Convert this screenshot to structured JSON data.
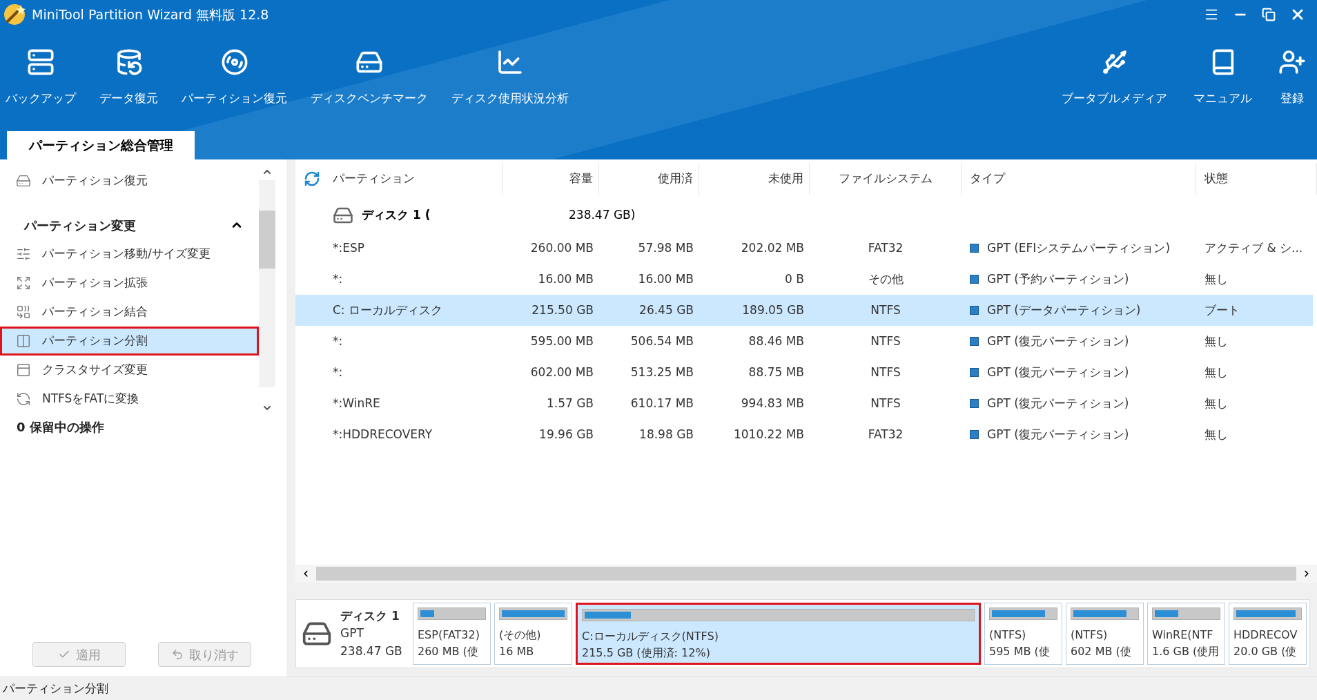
{
  "window": {
    "title": "MiniTool Partition Wizard 無料版 12.8"
  },
  "toolbar": {
    "left": [
      {
        "kind": "backup",
        "label": "バックアップ"
      },
      {
        "kind": "data",
        "label": "データ復元"
      },
      {
        "kind": "partition",
        "label": "パーティション復元"
      },
      {
        "kind": "bench",
        "label": "ディスクベンチマーク"
      },
      {
        "kind": "usage",
        "label": "ディスク使用状況分析"
      }
    ],
    "right": [
      {
        "kind": "media",
        "label": "ブータブルメディア"
      },
      {
        "kind": "manual",
        "label": "マニュアル"
      },
      {
        "kind": "register",
        "label": "登録"
      }
    ]
  },
  "tabs": [
    {
      "label": "パーティション総合管理",
      "selected": true
    }
  ],
  "sidebar": {
    "top_item": {
      "kind": "recover",
      "label": "パーティション復元"
    },
    "section": {
      "label": "パーティション変更",
      "expanded": true,
      "items": [
        {
          "kind": "move",
          "label": "パーティション移動/サイズ変更",
          "selected": false
        },
        {
          "kind": "extend",
          "label": "パーティション拡張",
          "selected": false
        },
        {
          "kind": "merge",
          "label": "パーティション結合",
          "selected": false
        },
        {
          "kind": "split",
          "label": "パーティション分割",
          "selected": true
        },
        {
          "kind": "cluster",
          "label": "クラスタサイズ変更",
          "selected": false
        },
        {
          "kind": "convert",
          "label": "NTFSをFATに変換",
          "selected": false
        }
      ]
    },
    "pending": "0 保留中の操作",
    "buttons": [
      {
        "kind": "apply",
        "label": "適用",
        "disabled": true
      },
      {
        "kind": "undo",
        "label": "取り消す",
        "disabled": true
      }
    ]
  },
  "table": {
    "columns": [
      "パーティション",
      "容量",
      "使用済",
      "未使用",
      "ファイルシステム",
      "タイプ",
      "状態"
    ],
    "disk_row": {
      "name": "ディスク 1 (",
      "size": "238.47 GB)"
    },
    "rows": [
      {
        "partition": "*:ESP",
        "capacity": "260.00 MB",
        "used": "57.98 MB",
        "unused": "202.02 MB",
        "fs": "FAT32",
        "type": "GPT (EFIシステムパーティション)",
        "status": "アクティブ & シ...",
        "selected": false
      },
      {
        "partition": "*:",
        "capacity": "16.00 MB",
        "used": "16.00 MB",
        "unused": "0 B",
        "fs": "その他",
        "type": "GPT (予約パーティション)",
        "status": "無し",
        "selected": false
      },
      {
        "partition": "C: ローカルディスク",
        "capacity": "215.50 GB",
        "used": "26.45 GB",
        "unused": "189.05 GB",
        "fs": "NTFS",
        "type": "GPT (データパーティション)",
        "status": "ブート",
        "selected": true
      },
      {
        "partition": "*:",
        "capacity": "595.00 MB",
        "used": "506.54 MB",
        "unused": "88.46 MB",
        "fs": "NTFS",
        "type": "GPT (復元パーティション)",
        "status": "無し",
        "selected": false
      },
      {
        "partition": "*:",
        "capacity": "602.00 MB",
        "used": "513.25 MB",
        "unused": "88.75 MB",
        "fs": "NTFS",
        "type": "GPT (復元パーティション)",
        "status": "無し",
        "selected": false
      },
      {
        "partition": "*:WinRE",
        "capacity": "1.57 GB",
        "used": "610.17 MB",
        "unused": "994.83 MB",
        "fs": "NTFS",
        "type": "GPT (復元パーティション)",
        "status": "無し",
        "selected": false
      },
      {
        "partition": "*:HDDRECOVERY",
        "capacity": "19.96 GB",
        "used": "18.98 GB",
        "unused": "1010.22 MB",
        "fs": "FAT32",
        "type": "GPT (復元パーティション)",
        "status": "無し",
        "selected": false
      }
    ]
  },
  "disk_map": {
    "disk": {
      "name": "ディスク 1",
      "scheme": "GPT",
      "size": "238.47 GB"
    },
    "segments": [
      {
        "label": "ESP(FAT32)",
        "size": "260 MB (使",
        "level": 0.22,
        "selected": false
      },
      {
        "label": "(その他)",
        "size": "16 MB",
        "level": 1.0,
        "selected": false
      },
      {
        "label": "C:ローカルディスク(NTFS)",
        "size": "215.5 GB (使用済: 12%)",
        "level": 0.12,
        "selected": true
      },
      {
        "label": "(NTFS)",
        "size": "595 MB (使",
        "level": 0.85,
        "selected": false
      },
      {
        "label": "(NTFS)",
        "size": "602 MB (使",
        "level": 0.85,
        "selected": false
      },
      {
        "label": "WinRE(NTF",
        "size": "1.6 GB (使用",
        "level": 0.37,
        "selected": false
      },
      {
        "label": "HDDRECOV",
        "size": "20.0 GB (使",
        "level": 0.95,
        "selected": false
      }
    ]
  },
  "status_bar": "パーティション分割"
}
